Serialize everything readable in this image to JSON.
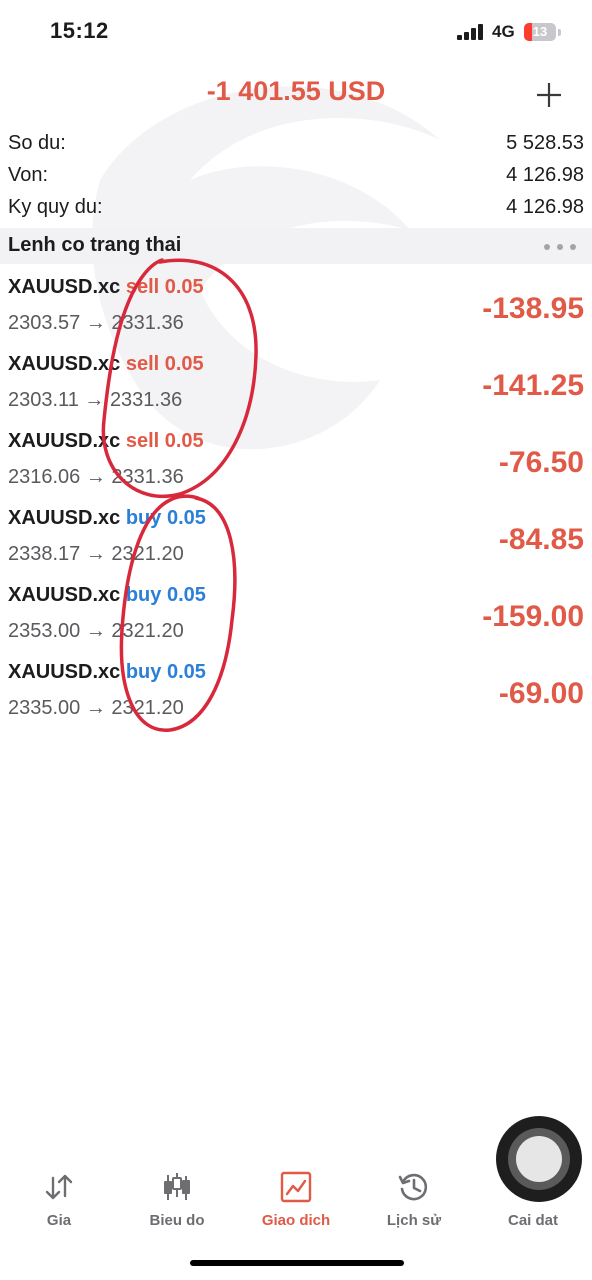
{
  "status_bar": {
    "time": "15:12",
    "network": "4G",
    "battery": "13"
  },
  "header": {
    "total_profit": "-1 401.55 USD"
  },
  "summary": [
    {
      "label": "So du:",
      "value": "5 528.53"
    },
    {
      "label": "Von:",
      "value": "4 126.98"
    },
    {
      "label": "Ky quy du:",
      "value": "4 126.98"
    }
  ],
  "section": {
    "title": "Lenh co trang thai"
  },
  "trades": [
    {
      "symbol": "XAUUSD.xc",
      "side": "sell",
      "volume": "0.05",
      "open_price": "2303.57",
      "arrow": "→",
      "current_price": "2331.36",
      "profit": "-138.95"
    },
    {
      "symbol": "XAUUSD.xc",
      "side": "sell",
      "volume": "0.05",
      "open_price": "2303.11",
      "arrow": "→",
      "current_price": "2331.36",
      "profit": "-141.25"
    },
    {
      "symbol": "XAUUSD.xc",
      "side": "sell",
      "volume": "0.05",
      "open_price": "2316.06",
      "arrow": "→",
      "current_price": "2331.36",
      "profit": "-76.50"
    },
    {
      "symbol": "XAUUSD.xc",
      "side": "buy",
      "volume": "0.05",
      "open_price": "2338.17",
      "arrow": "→",
      "current_price": "2321.20",
      "profit": "-84.85"
    },
    {
      "symbol": "XAUUSD.xc",
      "side": "buy",
      "volume": "0.05",
      "open_price": "2353.00",
      "arrow": "→",
      "current_price": "2321.20",
      "profit": "-159.00"
    },
    {
      "symbol": "XAUUSD.xc",
      "side": "buy",
      "volume": "0.05",
      "open_price": "2335.00",
      "arrow": "→",
      "current_price": "2321.20",
      "profit": "-69.00"
    }
  ],
  "tabs": [
    {
      "label": "Gia",
      "icon": "sort-arrows-icon"
    },
    {
      "label": "Bieu do",
      "icon": "candlestick-icon"
    },
    {
      "label": "Giao dich",
      "icon": "trade-chart-icon",
      "active": true
    },
    {
      "label": "Lịch sử",
      "icon": "history-clock-icon"
    },
    {
      "label": "Cai dat",
      "icon": "settings-gear-icon"
    }
  ],
  "colors": {
    "loss": "#e05a47",
    "sell": "#e05a47",
    "buy": "#2b7fd8",
    "annotation": "#d8283c"
  }
}
